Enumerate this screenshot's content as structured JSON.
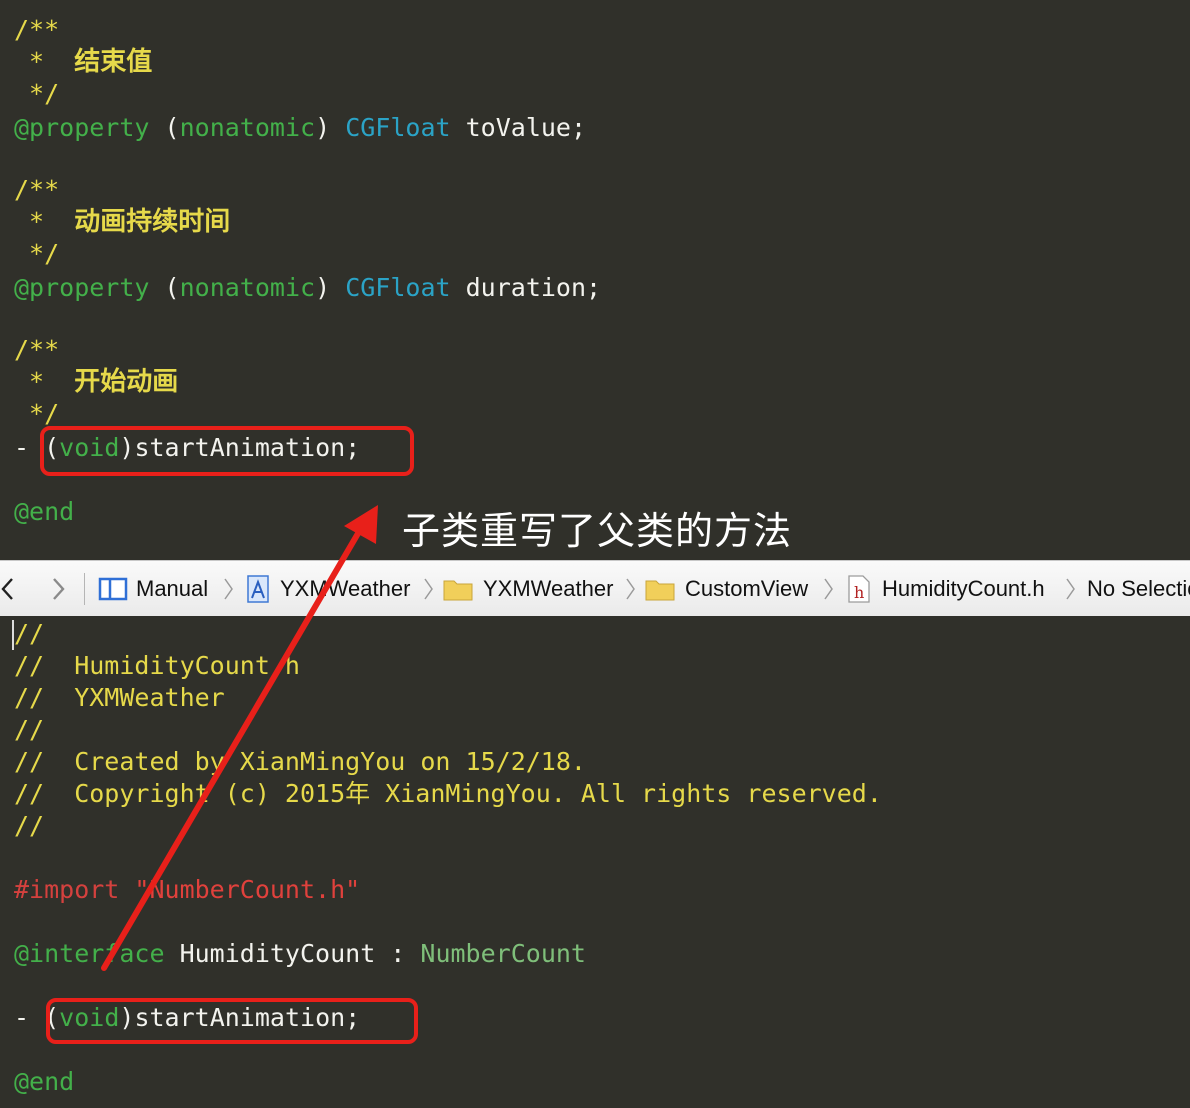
{
  "top_editor": {
    "block1": {
      "open": "/**",
      "star": " *  ",
      "text": "结束值",
      "close": " */"
    },
    "prop1": {
      "at": "@property",
      "attr": "nonatomic",
      "type": "CGFloat",
      "name": "toValue;"
    },
    "block2": {
      "open": "/**",
      "star": " *  ",
      "text": "动画持续时间",
      "close": " */"
    },
    "prop2": {
      "at": "@property",
      "attr": "nonatomic",
      "type": "CGFloat",
      "name": "duration;"
    },
    "block3": {
      "open": "/**",
      "star": " *  ",
      "text": "开始动画",
      "close": " */"
    },
    "method": {
      "dash": "- ",
      "ret": "void",
      "name": "startAnimation;"
    },
    "end": "@end"
  },
  "annotation": "子类重写了父类的方法",
  "jumpbar": {
    "back_icon": "chevron-left-icon",
    "forward_icon": "chevron-right-icon",
    "items": [
      {
        "label": "Manual",
        "icon": "related-items-icon"
      },
      {
        "label": "YXMWeather",
        "icon": "xcode-project-icon"
      },
      {
        "label": "YXMWeather",
        "icon": "folder-icon"
      },
      {
        "label": "CustomView",
        "icon": "folder-icon"
      },
      {
        "label": "HumidityCount.h",
        "icon": "header-file-icon"
      },
      {
        "label": "No Selection",
        "icon": ""
      }
    ]
  },
  "bottom_editor": {
    "header_comments": [
      "//",
      "//  HumidityCount.h",
      "//  YXMWeather",
      "//",
      "//  Created by XianMingYou on 15/2/18.",
      "//  Copyright (c) 2015年 XianMingYou. All rights reserved.",
      "//"
    ],
    "import_kw": "#import",
    "import_str": "\"NumberCount.h\"",
    "interface_kw": "@interface",
    "class_name": "HumidityCount",
    "colon": " : ",
    "super_class": "NumberCount",
    "method": {
      "dash": "- ",
      "ret": "void",
      "name": "startAnimation;"
    },
    "end": "@end"
  },
  "colors": {
    "editor_bg": "#30302a",
    "comment": "#e6d94a",
    "keyword": "#43b04a",
    "type": "#2ba3c6",
    "highlight": "#e8201a"
  }
}
